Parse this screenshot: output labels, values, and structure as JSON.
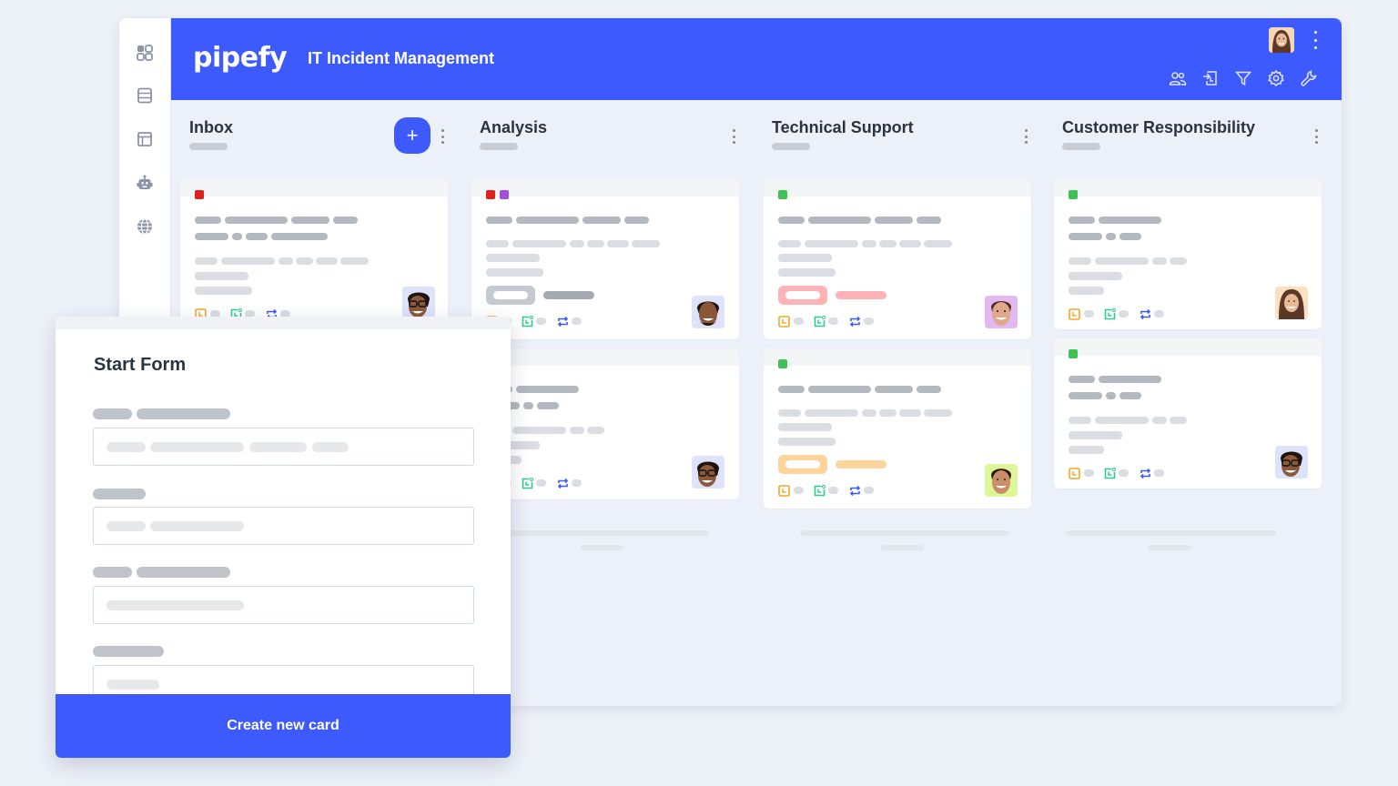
{
  "app": {
    "logo": "pipefy",
    "pipe_title": "IT Incident Management",
    "accent_color": "#3d5afe"
  },
  "sidebar": {
    "items": [
      {
        "icon": "dashboard-grid-icon"
      },
      {
        "icon": "database-table-icon"
      },
      {
        "icon": "layout-panel-icon"
      },
      {
        "icon": "robot-automation-icon"
      },
      {
        "icon": "globe-portal-icon"
      }
    ]
  },
  "header_tools": [
    {
      "icon": "members-icon"
    },
    {
      "icon": "import-icon"
    },
    {
      "icon": "filter-icon"
    },
    {
      "icon": "settings-gear-icon"
    },
    {
      "icon": "wrench-icon"
    }
  ],
  "phases": [
    {
      "title": "Inbox",
      "add_button": "+"
    },
    {
      "title": "Analysis"
    },
    {
      "title": "Technical Support"
    },
    {
      "title": "Customer Responsibility"
    }
  ],
  "label_colors": {
    "red": "#e02020",
    "purple": "#a24ee0",
    "green": "#3ec253"
  },
  "tag_colors": {
    "gray": "#c5cad1",
    "red": "#ffb3b6",
    "orange": "#ffd49a"
  },
  "start_form": {
    "title": "Start Form",
    "submit_label": "Create new card"
  }
}
